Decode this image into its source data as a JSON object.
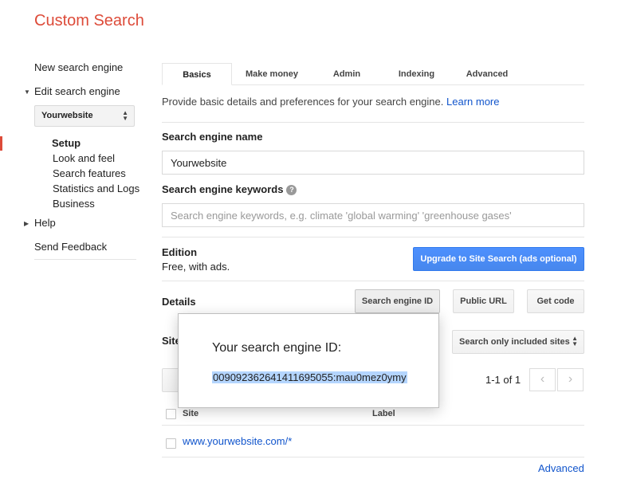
{
  "app": {
    "title": "Custom Search"
  },
  "sidebar": {
    "new_engine": "New search engine",
    "edit_engine": "Edit search engine",
    "engine_select": "Yourwebsite",
    "sub_items": [
      {
        "label": "Setup",
        "active": true
      },
      {
        "label": "Look and feel"
      },
      {
        "label": "Search features"
      },
      {
        "label": "Statistics and Logs"
      },
      {
        "label": "Business"
      }
    ],
    "help": "Help",
    "feedback": "Send Feedback"
  },
  "tabs": [
    {
      "label": "Basics",
      "active": true
    },
    {
      "label": "Make money"
    },
    {
      "label": "Admin"
    },
    {
      "label": "Indexing"
    },
    {
      "label": "Advanced"
    }
  ],
  "intro": {
    "text": "Provide basic details and preferences for your search engine.",
    "learn_more": "Learn more"
  },
  "name_field": {
    "label": "Search engine name",
    "value": "Yourwebsite"
  },
  "keywords_field": {
    "label": "Search engine keywords",
    "help_glyph": "?",
    "placeholder": "Search engine keywords, e.g. climate 'global warming' 'greenhouse gases'"
  },
  "edition": {
    "label": "Edition",
    "value": "Free, with ads.",
    "upgrade_button": "Upgrade to Site Search (ads optional)"
  },
  "details": {
    "label": "Details",
    "engine_id_button": "Search engine ID",
    "public_url_button": "Public URL",
    "get_code_button": "Get code"
  },
  "sites": {
    "label_partial": "Site",
    "search_mode": "Search only included sites",
    "pager_text": "1-1 of 1",
    "col_site": "Site",
    "col_label": "Label",
    "rows": [
      {
        "site": "www.yourwebsite.com/*"
      }
    ],
    "advanced_link": "Advanced"
  },
  "popup": {
    "title": "Your search engine ID:",
    "engine_id": "009092362641411695055:mau0mez0ymy"
  },
  "colors": {
    "brand": "#dd4b39",
    "link": "#1155cc",
    "primary_button": "#4d90fe",
    "selection": "#b4d5fe"
  },
  "icons": {
    "help": "help-circle-icon",
    "select_arrows": "up-down-arrows-icon",
    "expand": "triangle-down-icon",
    "collapse": "triangle-right-icon",
    "prev": "chevron-left-icon",
    "next": "chevron-right-icon"
  }
}
